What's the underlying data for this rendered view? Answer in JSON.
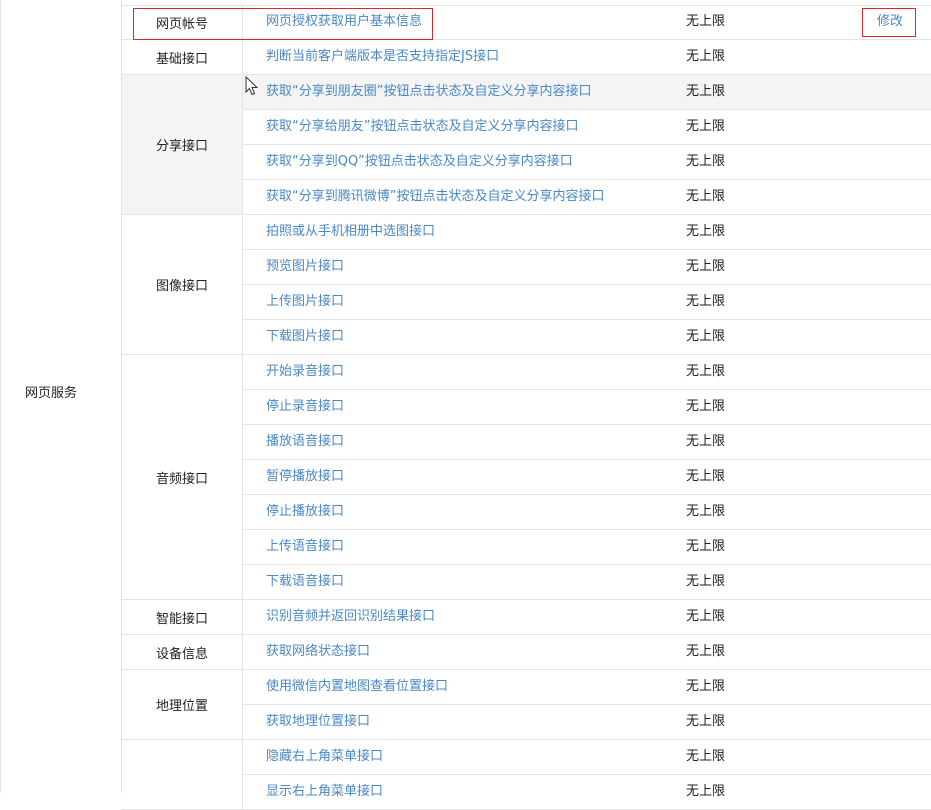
{
  "main_category": "网页服务",
  "categories": [
    {
      "label": "网页帐号",
      "span": 1
    },
    {
      "label": "基础接口",
      "span": 1
    },
    {
      "label": "分享接口",
      "span": 4
    },
    {
      "label": "图像接口",
      "span": 4
    },
    {
      "label": "音频接口",
      "span": 7
    },
    {
      "label": "智能接口",
      "span": 1
    },
    {
      "label": "设备信息",
      "span": 1
    },
    {
      "label": "地理位置",
      "span": 2
    },
    {
      "label": "",
      "span": 2
    }
  ],
  "rows": [
    {
      "name": "网页授权获取用户基本信息",
      "limit": "无上限",
      "action": "修改"
    },
    {
      "name": "判断当前客户端版本是否支持指定JS接口",
      "limit": "无上限"
    },
    {
      "name": "获取“分享到朋友圈”按钮点击状态及自定义分享内容接口",
      "limit": "无上限"
    },
    {
      "name": "获取“分享给朋友”按钮点击状态及自定义分享内容接口",
      "limit": "无上限"
    },
    {
      "name": "获取“分享到QQ”按钮点击状态及自定义分享内容接口",
      "limit": "无上限"
    },
    {
      "name": "获取“分享到腾讯微博”按钮点击状态及自定义分享内容接口",
      "limit": "无上限"
    },
    {
      "name": "拍照或从手机相册中选图接口",
      "limit": "无上限"
    },
    {
      "name": "预览图片接口",
      "limit": "无上限"
    },
    {
      "name": "上传图片接口",
      "limit": "无上限"
    },
    {
      "name": "下载图片接口",
      "limit": "无上限"
    },
    {
      "name": "开始录音接口",
      "limit": "无上限"
    },
    {
      "name": "停止录音接口",
      "limit": "无上限"
    },
    {
      "name": "播放语音接口",
      "limit": "无上限"
    },
    {
      "name": "暂停播放接口",
      "limit": "无上限"
    },
    {
      "name": "停止播放接口",
      "limit": "无上限"
    },
    {
      "name": "上传语音接口",
      "limit": "无上限"
    },
    {
      "name": "下载语音接口",
      "limit": "无上限"
    },
    {
      "name": "识别音频并返回识别结果接口",
      "limit": "无上限"
    },
    {
      "name": "获取网络状态接口",
      "limit": "无上限"
    },
    {
      "name": "使用微信内置地图查看位置接口",
      "limit": "无上限"
    },
    {
      "name": "获取地理位置接口",
      "limit": "无上限"
    },
    {
      "name": "隐藏右上角菜单接口",
      "limit": "无上限"
    },
    {
      "name": "显示右上角菜单接口",
      "limit": "无上限"
    }
  ],
  "colors": {
    "link": "#4a88c5",
    "highlight_box": "#e0252b",
    "hover_row_bg": "#f4f4f4"
  }
}
